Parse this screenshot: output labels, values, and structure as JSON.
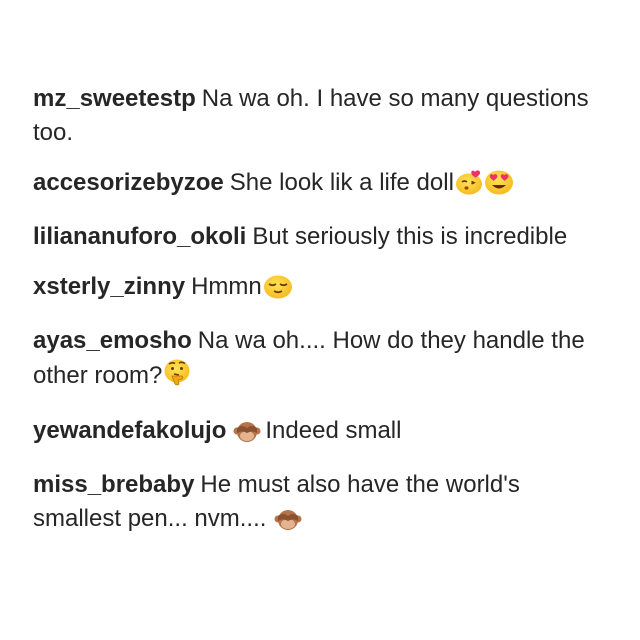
{
  "comments": [
    {
      "username": "mz_sweetestp",
      "text": "Na wa oh. I have so many questions too.",
      "emojis": []
    },
    {
      "username": "accesorizebyzoe",
      "text": "She look lik a life doll",
      "emojis": [
        "kissing-heart-emoji-icon",
        "heart-eyes-emoji-icon"
      ]
    },
    {
      "username": "liliananuforo_okoli",
      "text": "But seriously this is incredible",
      "emojis": []
    },
    {
      "username": "xsterly_zinny",
      "text": "Hmmn",
      "emojis": [
        "relieved-emoji-icon"
      ]
    },
    {
      "username": "ayas_emosho",
      "text": "Na wa oh.... How do they handle the other room?",
      "emojis": [
        "thinking-emoji-icon"
      ]
    },
    {
      "username": "yewandefakolujo",
      "text": "Indeed small",
      "emojis": [
        "see-no-evil-monkey-icon"
      ]
    },
    {
      "username": "miss_brebaby",
      "text": "He must also have the world's smallest pen... nvm....",
      "emojis": [
        "see-no-evil-monkey-icon"
      ]
    }
  ]
}
